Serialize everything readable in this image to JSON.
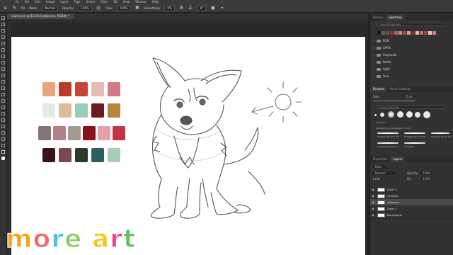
{
  "menubar": {
    "items": [
      "Ps",
      "File",
      "Edit",
      "Image",
      "Layer",
      "Type",
      "Select",
      "Filter",
      "3D",
      "View",
      "Window",
      "Help"
    ]
  },
  "options": {
    "mode_label": "Mode:",
    "mode_value": "Normal",
    "opacity_label": "Opacity:",
    "opacity_value": "100%",
    "flow_label": "Flow:",
    "flow_value": "100%",
    "smoothing_label": "Smoothing:",
    "smoothing_value": "0%",
    "angle_value": "0°",
    "brush_size": "50"
  },
  "document": {
    "tab_label": "сорги.psd @ 83.6% (наброски, RGB/8) *"
  },
  "palette_colors": [
    [
      "#e8a57b",
      "#bd3a2a",
      "#c74436",
      "#e3bdb3",
      "#d57980"
    ],
    [
      "#e3ebe4",
      "#dbbd97",
      "#9acdb6",
      "#6b1a1d",
      "#b8853d"
    ],
    [
      "#877376",
      "#b08287",
      "#a59a8e",
      "#88121b",
      "#e5a1a5",
      "#c33445"
    ],
    [
      "#3c1218",
      "#7a4a53",
      "#2c3a2c",
      "#28625c",
      "#a9cdb2"
    ]
  ],
  "panels": {
    "top_tabs": [
      "History",
      "Swatches"
    ],
    "swatch_search_placeholder": "Search Swatches",
    "swatch_colors": [
      "#1a1a1a",
      "#3c7b3f",
      "#5a5a5a",
      "#8a3a3a",
      "#b06060",
      "#c98a8a",
      "#a05050",
      "#d2a0a0",
      "#7a3030",
      "#e0b8b8",
      "#c27070",
      "#9a4848",
      "#e8c8c8",
      "#cc8080"
    ],
    "swatch_groups": [
      "RGB",
      "CMYK",
      "Grayscale",
      "Pastel",
      "Light",
      "Pure"
    ],
    "brush_tabs": [
      "Brushes",
      "Brush Settings"
    ],
    "size_label": "Size:",
    "size_value": "25 px",
    "brush_search_placeholder": "Search Brushes",
    "brush_preset_names": [
      "Sampled Brush 1 25",
      "Sampled Brush 2 25",
      "Sampled Brush 2 1",
      "Sampled Brush 2 37",
      "Chalk 90",
      "color-doc",
      "brushes_for_photoshop_by_tim0"
    ],
    "layers_tabs": [
      "Properties",
      "Layers"
    ],
    "kind_label": "Kind",
    "blend_mode": "Normal",
    "opacity_label": "Opacity:",
    "opacity_value": "100%",
    "lock_label": "Lock:",
    "fill_label": "Fill:",
    "fill_value": "100%",
    "layers": [
      "Layer 3",
      "палитра",
      "наброски",
      "Layer 2",
      "Background"
    ],
    "selected_layer": "наброски"
  },
  "logo": {
    "letters": [
      "m",
      "o",
      "r",
      "e",
      " ",
      "a",
      "r",
      "t"
    ],
    "colors": [
      "#f7a21b",
      "#f06c6c",
      "#46c3e8",
      "#8bd16a",
      "",
      "#f7c51b",
      "#e64d8f",
      "#5dc55a"
    ]
  }
}
